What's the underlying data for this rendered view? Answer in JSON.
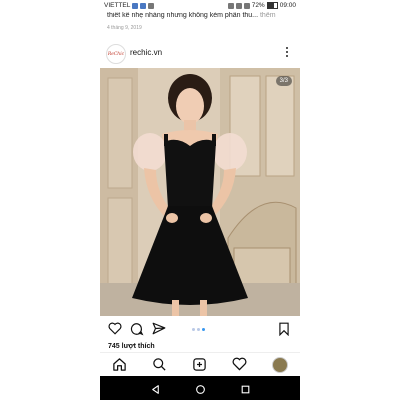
{
  "status_bar": {
    "carrier": "VIETTEL",
    "battery": "72%",
    "time": "09:00"
  },
  "caption": {
    "text": "thiết kế nhẹ nhàng nhưng không kém phần thu...",
    "more_label": "thêm"
  },
  "post": {
    "date": "4 tháng 9, 2019",
    "username": "rechic.vn",
    "avatar_text": "ReChic",
    "carousel_counter": "3/3",
    "likes": "745 lượt thích"
  },
  "icons": {
    "like": "heart-icon",
    "comment": "comment-icon",
    "share": "send-icon",
    "save": "bookmark-icon",
    "home": "home-icon",
    "search": "search-icon",
    "create": "plus-square-icon",
    "activity": "heart-icon",
    "profile": "avatar-icon"
  },
  "colors": {
    "dot_active": "#3897f0",
    "system_nav": "#000000"
  }
}
